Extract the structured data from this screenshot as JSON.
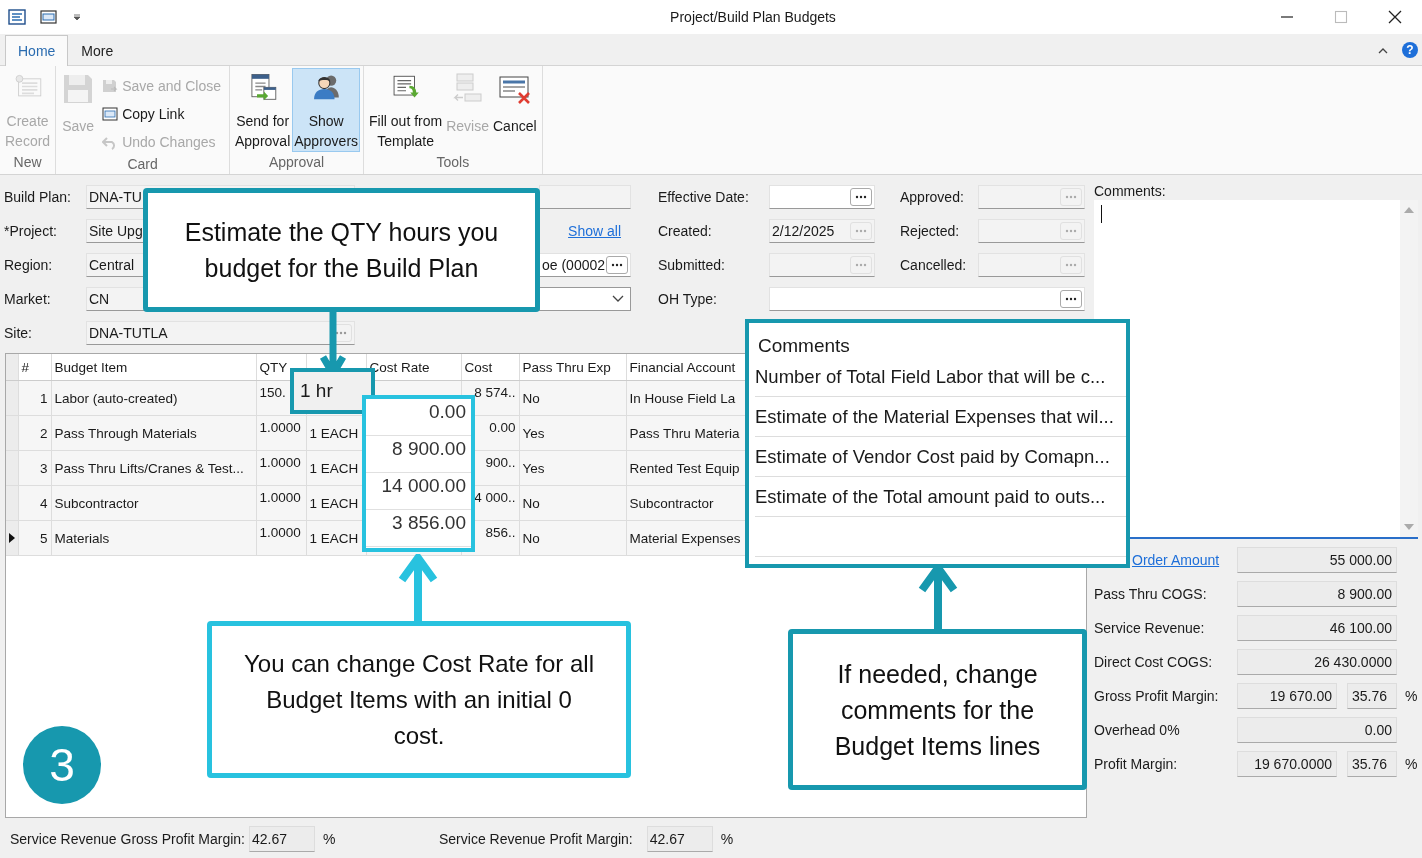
{
  "window": {
    "title": "Project/Build Plan Budgets"
  },
  "ribbon_tabs": [
    {
      "label": "Home",
      "selected": true
    },
    {
      "label": "More",
      "selected": false
    }
  ],
  "help": "?",
  "ribbon_groups": [
    {
      "label": "New",
      "buttons": [
        {
          "kind": "large",
          "label": "Create\nRecord",
          "disabled": true,
          "selected": false
        }
      ]
    },
    {
      "label": "Card",
      "buttons": [
        {
          "kind": "large",
          "label": "Save",
          "disabled": true,
          "selected": false
        },
        {
          "kind": "small",
          "label": "Save and Close",
          "disabled": true,
          "selected": false
        },
        {
          "kind": "small",
          "label": "Copy Link",
          "disabled": false,
          "selected": false
        },
        {
          "kind": "small",
          "label": "Undo Changes",
          "disabled": true,
          "selected": false
        }
      ]
    },
    {
      "label": "Approval",
      "buttons": [
        {
          "kind": "large",
          "label": "Send for\nApproval",
          "disabled": false,
          "selected": false
        },
        {
          "kind": "large",
          "label": "Show\nApprovers",
          "disabled": false,
          "selected": true
        }
      ]
    },
    {
      "label": "Tools",
      "buttons": [
        {
          "kind": "large",
          "label": "Fill out from\nTemplate",
          "disabled": false,
          "selected": false
        },
        {
          "kind": "large",
          "label": "Revise",
          "disabled": true,
          "selected": false
        },
        {
          "kind": "large",
          "label": "Cancel",
          "disabled": false,
          "selected": false
        }
      ]
    }
  ],
  "form_rows": [
    {
      "label": "Build Plan:",
      "value": "DNA-TU",
      "middle": {
        "kind": "field"
      },
      "right": [
        {
          "kind": "date",
          "label": "Effective Date:",
          "disabled": false
        },
        {
          "kind": "date",
          "label": "Approved:",
          "disabled": true
        }
      ]
    },
    {
      "label": "*Project:",
      "value": "Site Upg",
      "middle": {
        "kind": "link",
        "value": "Show all"
      },
      "right": [
        {
          "kind": "date",
          "label": "Created:",
          "value": "2/12/2025",
          "disabled": true
        },
        {
          "kind": "date",
          "label": "Rejected:",
          "disabled": true
        }
      ]
    },
    {
      "label": "Region:",
      "value": "Central",
      "middle": {
        "kind": "lookup",
        "value": "oe (00002"
      },
      "right": [
        {
          "kind": "date",
          "label": "Submitted:",
          "disabled": true
        },
        {
          "kind": "date",
          "label": "Cancelled:",
          "disabled": true
        }
      ]
    },
    {
      "label": "Market:",
      "value": "CN",
      "middle": {
        "kind": "dropdown"
      },
      "right": [
        {
          "kind": "wide",
          "label": "OH Type:",
          "disabled": false
        }
      ]
    },
    {
      "label": "Site:",
      "value": "DNA-TUTLA",
      "lookup": true,
      "middle": {
        "kind": "none"
      },
      "right": []
    }
  ],
  "table": {
    "columns": [
      "#",
      "Budget Item",
      "QTY",
      "Cost Rate",
      "Cost",
      "Pass Thru Exp",
      "Financial Account"
    ],
    "rows": [
      {
        "num": "1",
        "item": "Labor (auto-created)",
        "qty": "150.",
        "cost": "8 574..",
        "pass": "No",
        "account": "In House Field La",
        "current": false
      },
      {
        "num": "2",
        "item": "Pass Through Materials",
        "qty": "1.0000",
        "uom": "1 EACH",
        "cost": "0.00",
        "pass": "Yes",
        "account": "Pass Thru Materia",
        "current": false
      },
      {
        "num": "3",
        "item": "Pass Thru Lifts/Cranes & Test...",
        "qty": "1.0000",
        "uom": "1 EACH",
        "cost": "900..",
        "pass": "Yes",
        "account": "Rented Test Equip",
        "current": false
      },
      {
        "num": "4",
        "item": "Subcontractor",
        "qty": "1.0000",
        "uom": "1 EACH",
        "cost": "4 000..",
        "pass": "No",
        "account": "Subcontractor",
        "current": false
      },
      {
        "num": "5",
        "item": "Materials",
        "qty": "1.0000",
        "uom": "1 EACH",
        "cost": "856..",
        "pass": "No",
        "account": "Material Expenses",
        "current": true
      }
    ]
  },
  "comments_label": "Comments:",
  "summary": [
    {
      "kind": "link",
      "label": "Order Amount",
      "value": "55 000.00"
    },
    {
      "kind": "text",
      "label": "Pass Thru COGS:",
      "value": "8 900.00"
    },
    {
      "kind": "text",
      "label": "Service Revenue:",
      "value": "46 100.00"
    },
    {
      "kind": "text",
      "label": "Direct Cost COGS:",
      "value": "26 430.0000"
    },
    {
      "kind": "text",
      "label": "Gross Profit Margin:",
      "value": "19 670.00",
      "percent": "35.76",
      "unit": "%"
    },
    {
      "kind": "text",
      "label": "Overhead 0%",
      "value": "0.00"
    },
    {
      "kind": "text",
      "label": "Profit Margin:",
      "value": "19 670.0000",
      "percent": "35.76",
      "unit": "%"
    }
  ],
  "footer": [
    {
      "label": "Service Revenue Gross Profit Margin:",
      "value": "42.67",
      "unit": "%"
    },
    {
      "label": "Service Revenue Profit Margin:",
      "value": "42.67",
      "unit": "%"
    }
  ],
  "callouts": [
    {
      "text": "Estimate the QTY hours you\nbudget for the Build Plan"
    },
    {
      "text": "You can change Cost Rate for all\nBudget Items with an initial 0\ncost."
    },
    {
      "text": "If needed, change\ncomments for the\nBudget Items lines"
    }
  ],
  "uom_zoom": "1 hr",
  "cost_rate_zoom": [
    "0.00",
    "8 900.00",
    "14 000.00",
    "3 856.00"
  ],
  "comments_zoom": {
    "title": "Comments",
    "lines": [
      "Number of Total Field Labor that will be c...",
      "Estimate of the Material Expenses that wil...",
      "Estimate of Vendor Cost paid by Comapn...",
      "Estimate of the Total amount paid to outs..."
    ]
  },
  "step": "3"
}
